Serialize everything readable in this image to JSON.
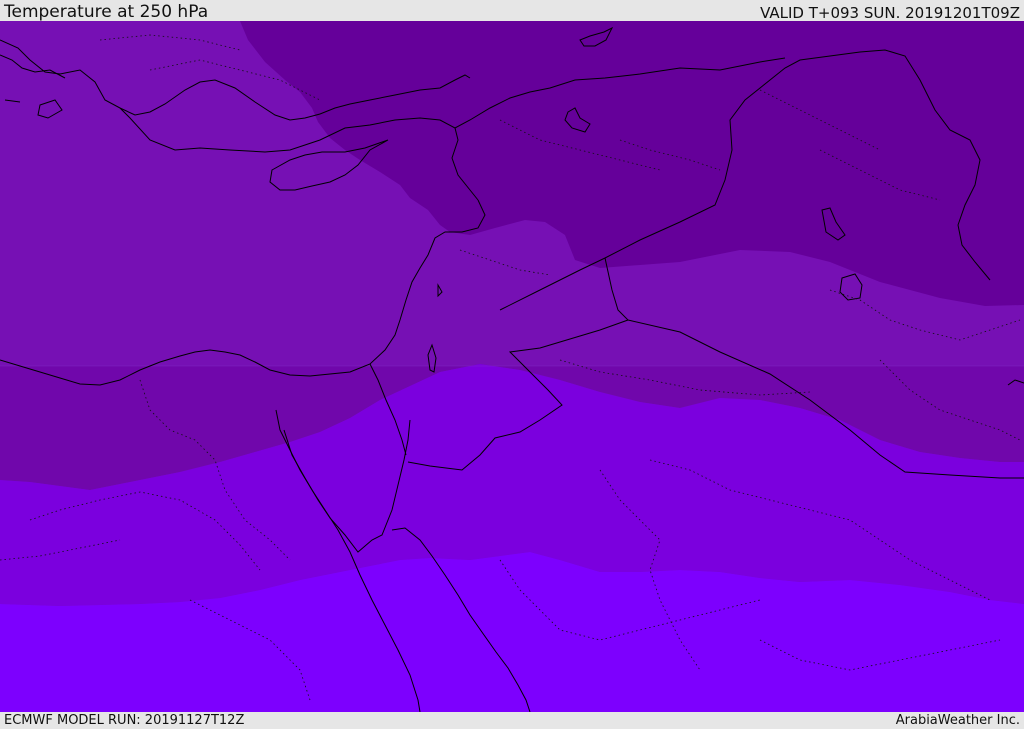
{
  "header": {
    "title": "Temperature at 250 hPa",
    "valid": "VALID T+093 SUN. 20191201T09Z"
  },
  "footer": {
    "model_run": "ECMWF MODEL RUN: 20191127T12Z",
    "credit": "ArabiaWeather Inc."
  },
  "map": {
    "field": "temperature",
    "level": "250 hPa",
    "colors": {
      "band_coldest": "#65009a",
      "band_cold": "#7610b4",
      "band_mid": "#7007ab",
      "band_warm": "#7b00de",
      "band_warmest": "#7d00fe",
      "coastline": "#000000",
      "border": "#1a1a1a"
    }
  }
}
